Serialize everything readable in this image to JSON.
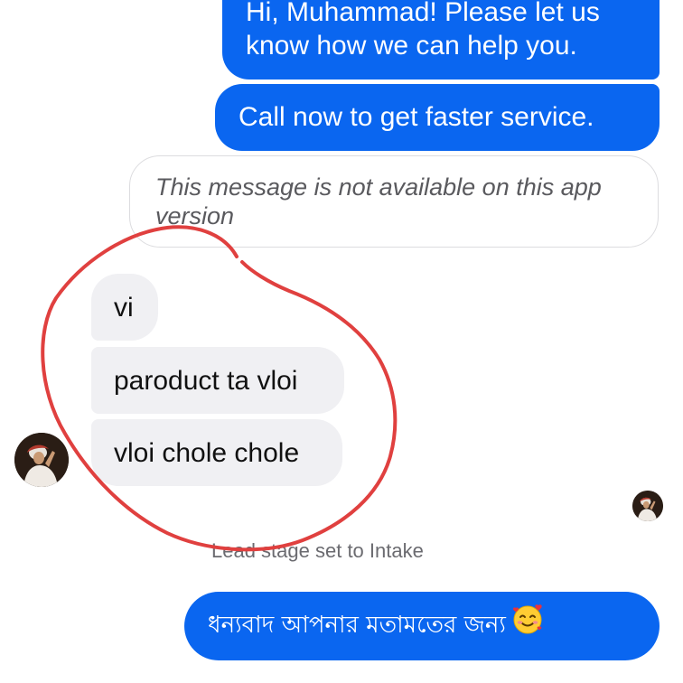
{
  "messages": {
    "outgoing_1": "Hi, Muhammad! Please let us know how we can help you.",
    "outgoing_2": "Call now to get faster service.",
    "unavailable_notice": "This message is not available on this app version",
    "incoming": [
      {
        "text": "vi"
      },
      {
        "text": "paroduct ta vloi"
      },
      {
        "text": "vloi chole chole"
      }
    ],
    "system_event": "Lead stage set to Intake",
    "outgoing_3": "ধন্যবাদ আপনার মতামতের জন্য"
  },
  "icons": {
    "reaction_emoji": "smiling-face-with-hearts-emoji",
    "sender_avatar": "avatar-photo",
    "read_receipt_avatar": "read-receipt-avatar"
  },
  "colors": {
    "outgoing_bubble": "#0a66f0",
    "incoming_bubble": "#f0f0f3",
    "annotation_circle": "#e0403f",
    "system_text": "#6b6b70"
  }
}
